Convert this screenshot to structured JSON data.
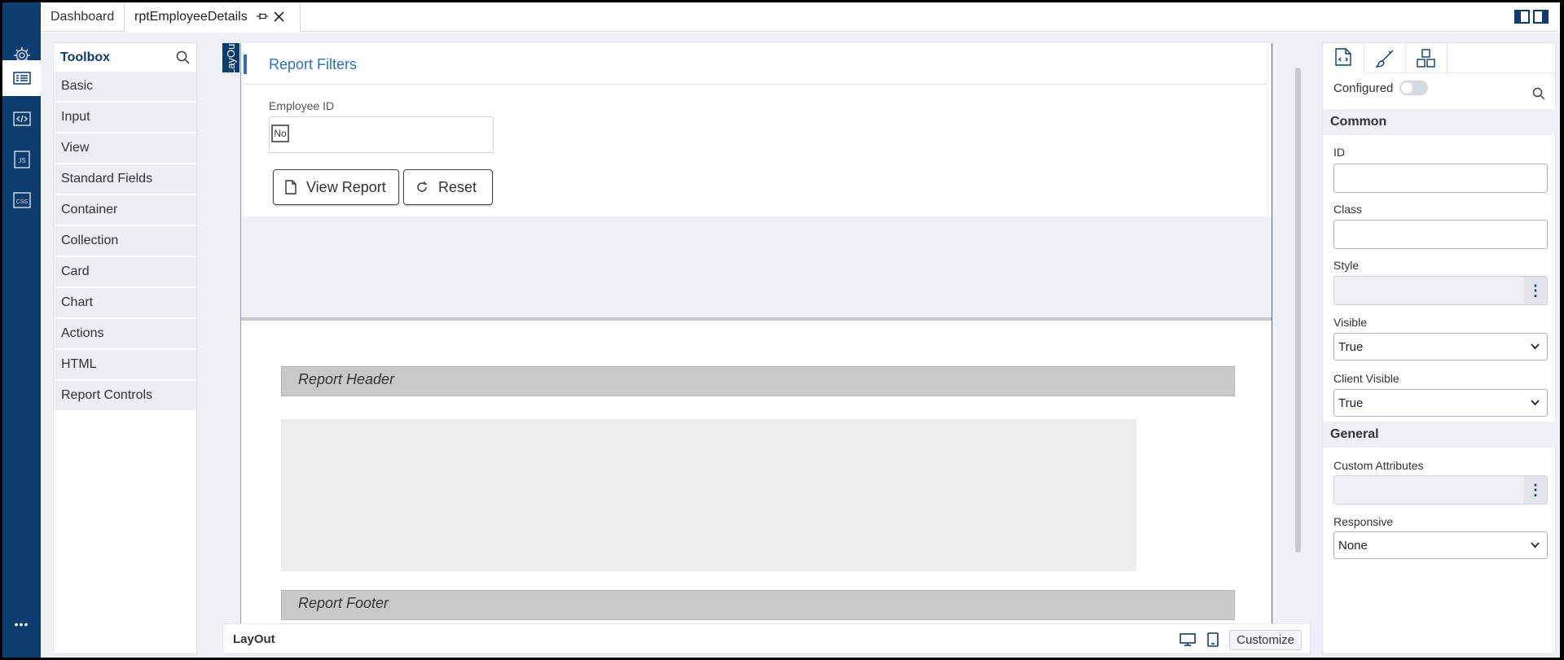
{
  "tabs": [
    {
      "label": "Dashboard"
    },
    {
      "label": "rptEmployeeDetails"
    }
  ],
  "rail": {
    "icons": [
      "gear-icon",
      "layout-icon",
      "code-icon",
      "js-icon",
      "css-icon",
      "more-icon"
    ],
    "js_text": "JS",
    "css_text": "CSS",
    "more_text": "•••"
  },
  "toolbox": {
    "title": "Toolbox",
    "items": [
      "Basic",
      "Input",
      "View",
      "Standard Fields",
      "Container",
      "Collection",
      "Card",
      "Chart",
      "Actions",
      "HTML",
      "Report Controls"
    ]
  },
  "canvas": {
    "layout_tab": "LayOut",
    "filters": {
      "title": "Report Filters",
      "field_label": "Employee ID",
      "checkbox_text": "No",
      "view_button": "View Report",
      "reset_button": "Reset"
    },
    "report_header": "Report Header",
    "report_footer": "Report Footer"
  },
  "status_bar": {
    "label": "LayOut",
    "customize": "Customize"
  },
  "props": {
    "configured_label": "Configured",
    "configured_on": false,
    "common_title": "Common",
    "id_label": "ID",
    "id_value": "",
    "class_label": "Class",
    "class_value": "",
    "style_label": "Style",
    "visible_label": "Visible",
    "visible_value": "True",
    "client_visible_label": "Client Visible",
    "client_visible_value": "True",
    "general_title": "General",
    "custom_attr_label": "Custom Attributes",
    "responsive_label": "Responsive",
    "responsive_value": "None"
  },
  "colors": {
    "brand": "#0d3c6e",
    "accent": "#2f6fc1"
  }
}
